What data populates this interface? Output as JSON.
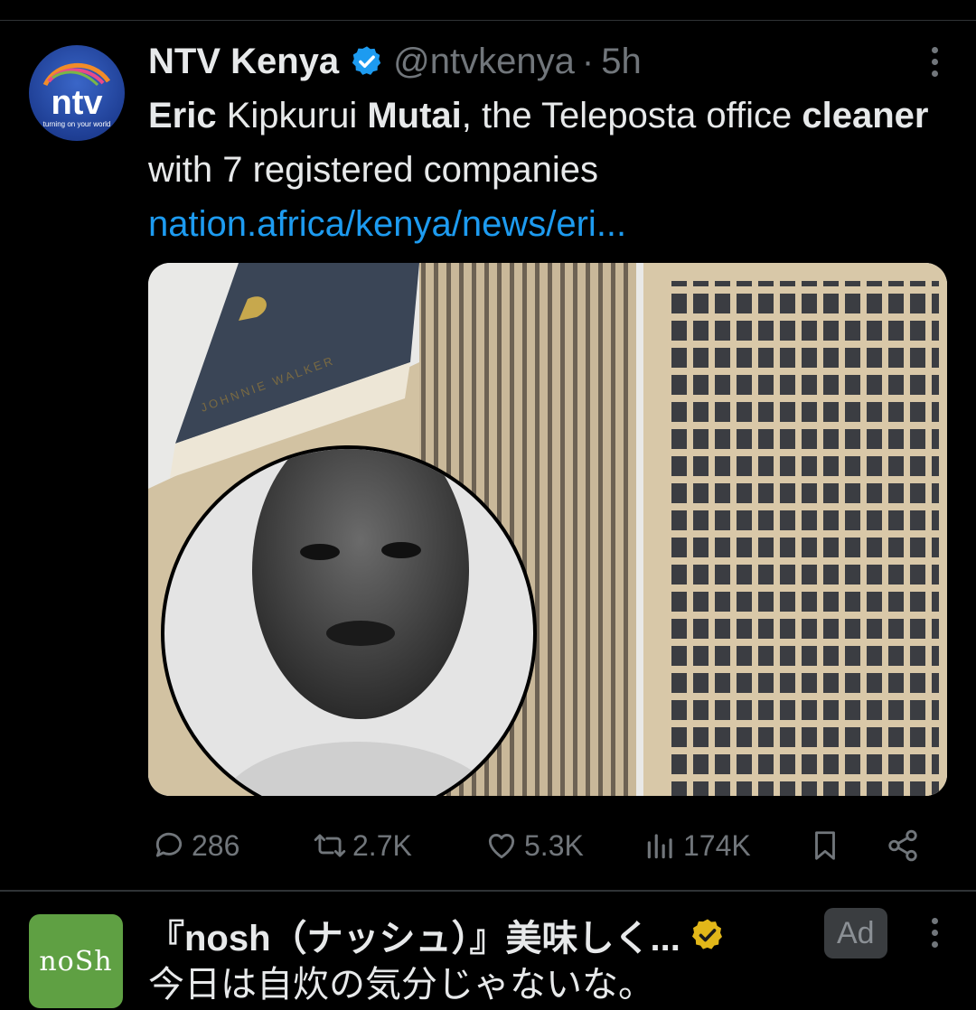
{
  "tweet": {
    "author_name": "NTV Kenya",
    "handle": "@ntvkenya",
    "separator": "·",
    "time": "5h",
    "avatar_logo_text": "ntv",
    "avatar_tagline": "turning on your world",
    "text_segments": [
      {
        "text": "Eric",
        "bold": true
      },
      {
        "text": " Kipkurui ",
        "bold": false
      },
      {
        "text": "Mutai",
        "bold": true
      },
      {
        "text": ", the Teleposta office ",
        "bold": false
      },
      {
        "text": "cleaner",
        "bold": true
      },
      {
        "text": " with 7 registered companies",
        "bold": false
      }
    ],
    "link_text": "nation.africa/kenya/news/eri...",
    "image_billboard_text": "JOHNNIE WALKER",
    "actions": {
      "reply_count": "286",
      "retweet_count": "2.7K",
      "like_count": "5.3K",
      "view_count": "174K"
    }
  },
  "ad": {
    "avatar_text": "noSh",
    "title": "『nosh（ナッシュ）』美味しく...",
    "badge": "Ad",
    "text": "今日は自炊の気分じゃないな。"
  },
  "colors": {
    "background": "#000000",
    "text": "#e7e9ea",
    "muted": "#71767b",
    "link": "#1d9bf0",
    "verified_blue": "#1d9bf0",
    "verified_gold": "#e2b719",
    "ad_avatar_green": "#5fa043"
  }
}
